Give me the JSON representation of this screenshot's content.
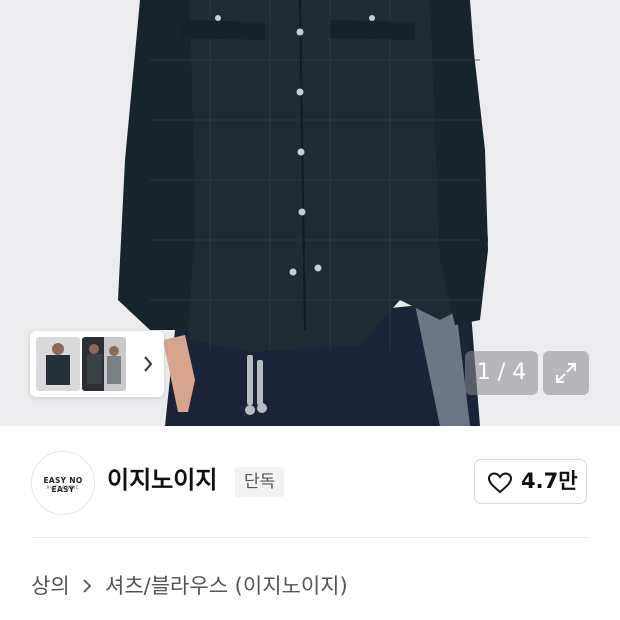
{
  "product_image": {
    "counter": {
      "current": "1",
      "total": "4",
      "text": "1 / 4"
    },
    "expand_icon": "expand-icon",
    "thumbnail_next_icon": "chevron-right-icon"
  },
  "brand": {
    "logo_line1": "EASY NO EASY",
    "logo_line2": "AUTHENTIC",
    "name": "이지노이지",
    "badge": "단독",
    "like_count": "4.7만",
    "like_icon": "heart-icon"
  },
  "breadcrumb": {
    "items": [
      "상의",
      "셔츠/블라우스 (이지노이지)"
    ],
    "separator_icon": "chevron-right-icon"
  }
}
